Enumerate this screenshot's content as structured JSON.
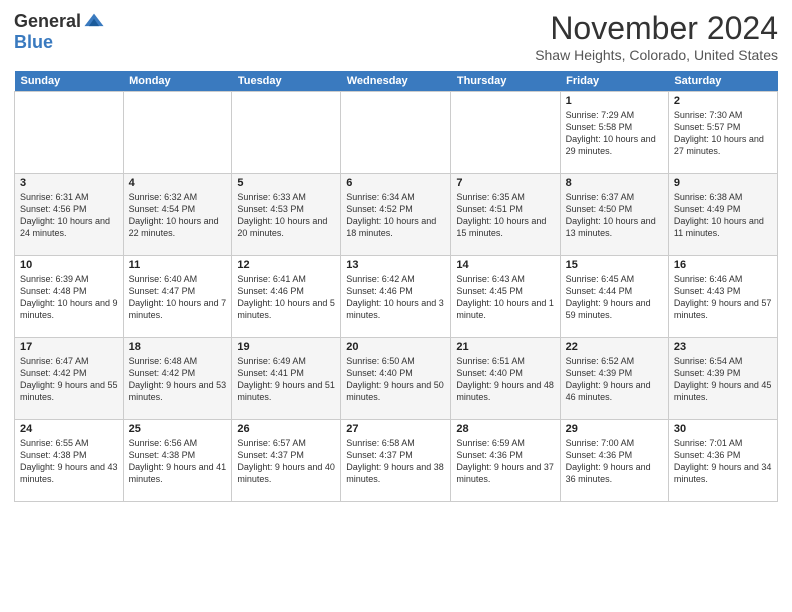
{
  "header": {
    "logo_general": "General",
    "logo_blue": "Blue",
    "month_title": "November 2024",
    "location": "Shaw Heights, Colorado, United States"
  },
  "weekdays": [
    "Sunday",
    "Monday",
    "Tuesday",
    "Wednesday",
    "Thursday",
    "Friday",
    "Saturday"
  ],
  "weeks": [
    [
      {
        "day": "",
        "info": ""
      },
      {
        "day": "",
        "info": ""
      },
      {
        "day": "",
        "info": ""
      },
      {
        "day": "",
        "info": ""
      },
      {
        "day": "",
        "info": ""
      },
      {
        "day": "1",
        "info": "Sunrise: 7:29 AM\nSunset: 5:58 PM\nDaylight: 10 hours and 29 minutes."
      },
      {
        "day": "2",
        "info": "Sunrise: 7:30 AM\nSunset: 5:57 PM\nDaylight: 10 hours and 27 minutes."
      }
    ],
    [
      {
        "day": "3",
        "info": "Sunrise: 6:31 AM\nSunset: 4:56 PM\nDaylight: 10 hours and 24 minutes."
      },
      {
        "day": "4",
        "info": "Sunrise: 6:32 AM\nSunset: 4:54 PM\nDaylight: 10 hours and 22 minutes."
      },
      {
        "day": "5",
        "info": "Sunrise: 6:33 AM\nSunset: 4:53 PM\nDaylight: 10 hours and 20 minutes."
      },
      {
        "day": "6",
        "info": "Sunrise: 6:34 AM\nSunset: 4:52 PM\nDaylight: 10 hours and 18 minutes."
      },
      {
        "day": "7",
        "info": "Sunrise: 6:35 AM\nSunset: 4:51 PM\nDaylight: 10 hours and 15 minutes."
      },
      {
        "day": "8",
        "info": "Sunrise: 6:37 AM\nSunset: 4:50 PM\nDaylight: 10 hours and 13 minutes."
      },
      {
        "day": "9",
        "info": "Sunrise: 6:38 AM\nSunset: 4:49 PM\nDaylight: 10 hours and 11 minutes."
      }
    ],
    [
      {
        "day": "10",
        "info": "Sunrise: 6:39 AM\nSunset: 4:48 PM\nDaylight: 10 hours and 9 minutes."
      },
      {
        "day": "11",
        "info": "Sunrise: 6:40 AM\nSunset: 4:47 PM\nDaylight: 10 hours and 7 minutes."
      },
      {
        "day": "12",
        "info": "Sunrise: 6:41 AM\nSunset: 4:46 PM\nDaylight: 10 hours and 5 minutes."
      },
      {
        "day": "13",
        "info": "Sunrise: 6:42 AM\nSunset: 4:46 PM\nDaylight: 10 hours and 3 minutes."
      },
      {
        "day": "14",
        "info": "Sunrise: 6:43 AM\nSunset: 4:45 PM\nDaylight: 10 hours and 1 minute."
      },
      {
        "day": "15",
        "info": "Sunrise: 6:45 AM\nSunset: 4:44 PM\nDaylight: 9 hours and 59 minutes."
      },
      {
        "day": "16",
        "info": "Sunrise: 6:46 AM\nSunset: 4:43 PM\nDaylight: 9 hours and 57 minutes."
      }
    ],
    [
      {
        "day": "17",
        "info": "Sunrise: 6:47 AM\nSunset: 4:42 PM\nDaylight: 9 hours and 55 minutes."
      },
      {
        "day": "18",
        "info": "Sunrise: 6:48 AM\nSunset: 4:42 PM\nDaylight: 9 hours and 53 minutes."
      },
      {
        "day": "19",
        "info": "Sunrise: 6:49 AM\nSunset: 4:41 PM\nDaylight: 9 hours and 51 minutes."
      },
      {
        "day": "20",
        "info": "Sunrise: 6:50 AM\nSunset: 4:40 PM\nDaylight: 9 hours and 50 minutes."
      },
      {
        "day": "21",
        "info": "Sunrise: 6:51 AM\nSunset: 4:40 PM\nDaylight: 9 hours and 48 minutes."
      },
      {
        "day": "22",
        "info": "Sunrise: 6:52 AM\nSunset: 4:39 PM\nDaylight: 9 hours and 46 minutes."
      },
      {
        "day": "23",
        "info": "Sunrise: 6:54 AM\nSunset: 4:39 PM\nDaylight: 9 hours and 45 minutes."
      }
    ],
    [
      {
        "day": "24",
        "info": "Sunrise: 6:55 AM\nSunset: 4:38 PM\nDaylight: 9 hours and 43 minutes."
      },
      {
        "day": "25",
        "info": "Sunrise: 6:56 AM\nSunset: 4:38 PM\nDaylight: 9 hours and 41 minutes."
      },
      {
        "day": "26",
        "info": "Sunrise: 6:57 AM\nSunset: 4:37 PM\nDaylight: 9 hours and 40 minutes."
      },
      {
        "day": "27",
        "info": "Sunrise: 6:58 AM\nSunset: 4:37 PM\nDaylight: 9 hours and 38 minutes."
      },
      {
        "day": "28",
        "info": "Sunrise: 6:59 AM\nSunset: 4:36 PM\nDaylight: 9 hours and 37 minutes."
      },
      {
        "day": "29",
        "info": "Sunrise: 7:00 AM\nSunset: 4:36 PM\nDaylight: 9 hours and 36 minutes."
      },
      {
        "day": "30",
        "info": "Sunrise: 7:01 AM\nSunset: 4:36 PM\nDaylight: 9 hours and 34 minutes."
      }
    ]
  ]
}
